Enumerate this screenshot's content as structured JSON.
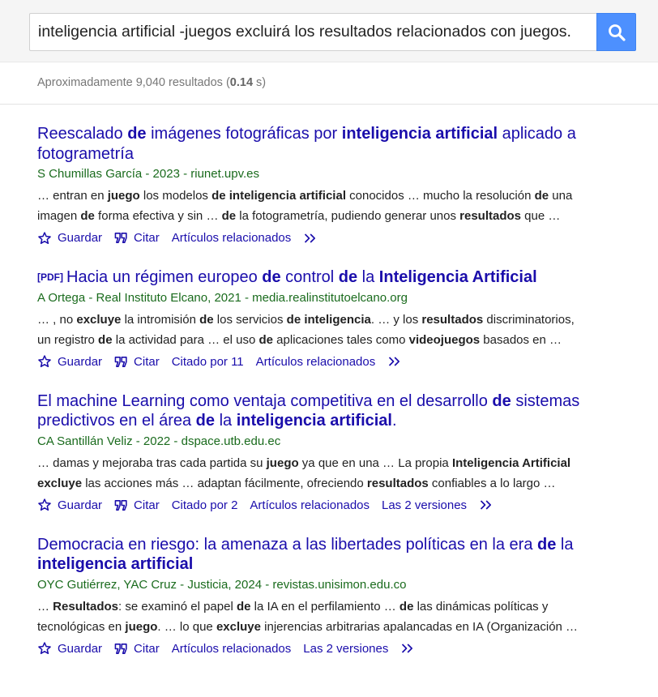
{
  "search": {
    "query": "inteligencia artificial -juegos excluirá los resultados relacionados con juegos.",
    "button_icon": "search-icon"
  },
  "stats": {
    "prefix": "Aproximadamente 9,040 resultados (",
    "time": "0.14",
    "suffix": " s)"
  },
  "action_labels": {
    "save": "Guardar",
    "cite": "Citar",
    "related": "Artículos relacionados"
  },
  "colors": {
    "link": "#1a0dab",
    "meta": "#1a6b1d",
    "search_button": "#4d90fe"
  },
  "results": [
    {
      "tag": "",
      "title": [
        {
          "t": "Reescalado ",
          "b": false
        },
        {
          "t": "de",
          "b": true
        },
        {
          "t": " imágenes fotográficas por ",
          "b": false
        },
        {
          "t": "inteligencia artificial",
          "b": true
        },
        {
          "t": " aplicado a fotogrametría",
          "b": false
        }
      ],
      "meta": "S Chumillas García - 2023 - riunet.upv.es",
      "snippet": [
        [
          {
            "t": "… entran en ",
            "b": false
          },
          {
            "t": "juego",
            "b": true
          },
          {
            "t": " los modelos ",
            "b": false
          },
          {
            "t": "de inteligencia artificial",
            "b": true
          },
          {
            "t": " conocidos … mucho la resolución ",
            "b": false
          },
          {
            "t": "de",
            "b": true
          },
          {
            "t": " una",
            "b": false
          }
        ],
        [
          {
            "t": "imagen ",
            "b": false
          },
          {
            "t": "de",
            "b": true
          },
          {
            "t": " forma efectiva y sin … ",
            "b": false
          },
          {
            "t": "de",
            "b": true
          },
          {
            "t": " la fotogrametría, pudiendo generar unos ",
            "b": false
          },
          {
            "t": "resultados",
            "b": true
          },
          {
            "t": " que …",
            "b": false
          }
        ]
      ],
      "cited_by": "",
      "versions": ""
    },
    {
      "tag": "[PDF]",
      "title": [
        {
          "t": "Hacia un régimen europeo ",
          "b": false
        },
        {
          "t": "de",
          "b": true
        },
        {
          "t": " control ",
          "b": false
        },
        {
          "t": "de",
          "b": true
        },
        {
          "t": " la ",
          "b": false
        },
        {
          "t": "Inteligencia Artificial",
          "b": true
        }
      ],
      "meta": "A Ortega - Real Instituto Elcano, 2021 - media.realinstitutoelcano.org",
      "snippet": [
        [
          {
            "t": "… , no ",
            "b": false
          },
          {
            "t": "excluye",
            "b": true
          },
          {
            "t": " la intromisión ",
            "b": false
          },
          {
            "t": "de",
            "b": true
          },
          {
            "t": " los servicios ",
            "b": false
          },
          {
            "t": "de inteligencia",
            "b": true
          },
          {
            "t": ". … y los ",
            "b": false
          },
          {
            "t": "resultados",
            "b": true
          },
          {
            "t": " discriminatorios,",
            "b": false
          }
        ],
        [
          {
            "t": "un registro ",
            "b": false
          },
          {
            "t": "de",
            "b": true
          },
          {
            "t": " la actividad para … el uso ",
            "b": false
          },
          {
            "t": "de",
            "b": true
          },
          {
            "t": " aplicaciones tales como ",
            "b": false
          },
          {
            "t": "videojuegos",
            "b": true
          },
          {
            "t": " basados en …",
            "b": false
          }
        ]
      ],
      "cited_by": "Citado por 11",
      "versions": ""
    },
    {
      "tag": "",
      "title": [
        {
          "t": "El machine Learning como ventaja competitiva en el desarrollo ",
          "b": false
        },
        {
          "t": "de",
          "b": true
        },
        {
          "t": " sistemas predictivos en el área ",
          "b": false
        },
        {
          "t": "de",
          "b": true
        },
        {
          "t": " la ",
          "b": false
        },
        {
          "t": "inteligencia artificial",
          "b": true
        },
        {
          "t": ".",
          "b": false
        }
      ],
      "meta": "CA Santillán Veliz - 2022 - dspace.utb.edu.ec",
      "snippet": [
        [
          {
            "t": "… damas y mejoraba tras cada partida su ",
            "b": false
          },
          {
            "t": "juego",
            "b": true
          },
          {
            "t": " ya que en una … La propia ",
            "b": false
          },
          {
            "t": "Inteligencia Artificial",
            "b": true
          }
        ],
        [
          {
            "t": "excluye",
            "b": true
          },
          {
            "t": " las acciones más … adaptan fácilmente, ofreciendo ",
            "b": false
          },
          {
            "t": "resultados",
            "b": true
          },
          {
            "t": " confiables a lo largo …",
            "b": false
          }
        ]
      ],
      "cited_by": "Citado por 2",
      "versions": "Las 2 versiones"
    },
    {
      "tag": "",
      "title": [
        {
          "t": "Democracia en riesgo: la amenaza a las libertades políticas en la era ",
          "b": false
        },
        {
          "t": "de",
          "b": true
        },
        {
          "t": " la ",
          "b": false
        },
        {
          "t": "inteligencia artificial",
          "b": true
        }
      ],
      "meta": "OYC Gutiérrez, YAC Cruz - Justicia, 2024 - revistas.unisimon.edu.co",
      "snippet": [
        [
          {
            "t": "… ",
            "b": false
          },
          {
            "t": "Resultados",
            "b": true
          },
          {
            "t": ": se examinó el papel ",
            "b": false
          },
          {
            "t": "de",
            "b": true
          },
          {
            "t": " la IA en el perfilamiento … ",
            "b": false
          },
          {
            "t": "de",
            "b": true
          },
          {
            "t": " las dinámicas políticas y",
            "b": false
          }
        ],
        [
          {
            "t": "tecnológicas en ",
            "b": false
          },
          {
            "t": "juego",
            "b": true
          },
          {
            "t": ". … lo que ",
            "b": false
          },
          {
            "t": "excluye",
            "b": true
          },
          {
            "t": " injerencias arbitrarias apalancadas en IA (Organización …",
            "b": false
          }
        ]
      ],
      "cited_by": "",
      "versions": "Las 2 versiones"
    }
  ]
}
